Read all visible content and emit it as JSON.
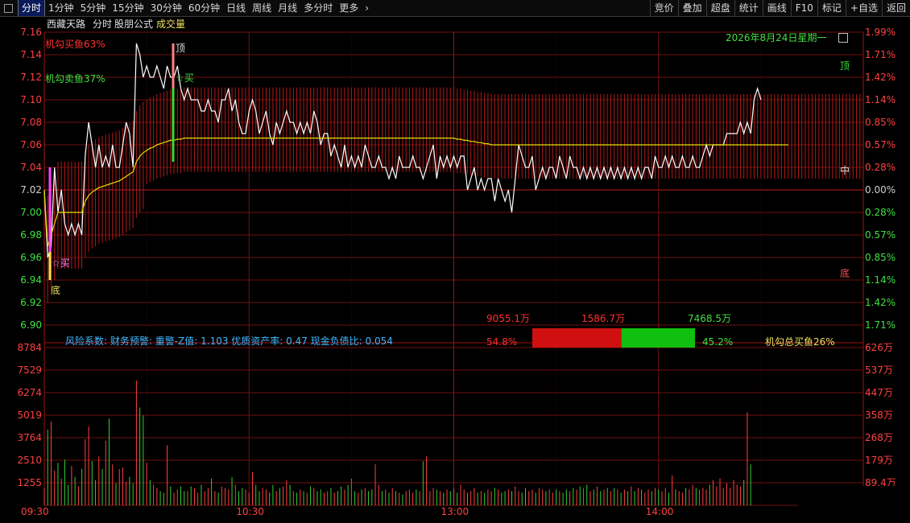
{
  "toolbar": {
    "left_tabs": [
      "分时",
      "1分钟",
      "5分钟",
      "15分钟",
      "30分钟",
      "60分钟",
      "日线",
      "周线",
      "月线",
      "多分时",
      "更多"
    ],
    "right_buttons": [
      "竞价",
      "叠加",
      "超盘",
      "统计",
      "画线",
      "F10",
      "标记",
      "+自选",
      "返回"
    ]
  },
  "header": {
    "stock_name": "西藏天路",
    "mode": "分时",
    "formula": "股朋公式",
    "indicator": "成交量",
    "date": "2026年8月24日星期一"
  },
  "price_axis": {
    "left": [
      "7.16",
      "7.14",
      "7.12",
      "7.10",
      "7.08",
      "7.06",
      "7.04",
      "7.02",
      "7.00",
      "6.98",
      "6.96",
      "6.94",
      "6.92",
      "6.90"
    ],
    "right": [
      "1.99%",
      "1.71%",
      "1.42%",
      "1.14%",
      "0.85%",
      "0.57%",
      "0.28%",
      "0.00%",
      "0.28%",
      "0.57%",
      "0.85%",
      "1.14%",
      "1.42%",
      "1.71%"
    ]
  },
  "volume_axis": {
    "left": [
      "8784",
      "7529",
      "6274",
      "5019",
      "3764",
      "2510",
      "1255"
    ],
    "right": [
      "626万",
      "537万",
      "447万",
      "358万",
      "268万",
      "179万",
      "89.4万"
    ]
  },
  "time_axis": [
    "09:30",
    "10:30",
    "13:00",
    "14:00"
  ],
  "annotations": {
    "sell_ratio": "机勾买鱼63%",
    "buy_ratio": "机勾卖鱼37%",
    "top_mark": "顶",
    "bottom_mark": "底",
    "buy_mark": "☆买",
    "right_top": "顶",
    "right_mid": "中",
    "right_bottom": "底",
    "risk_line": "风险系数: 财务预警: 重警-Z值: 1.103 优质资产率: 0.47 现金负债比: 0.054"
  },
  "flow": {
    "red_amount": "9055.1万",
    "mid_amount": "1586.7万",
    "green_amount": "7468.5万",
    "red_pct": "54.8%",
    "green_pct": "45.2%",
    "total": "机勾总买鱼26%",
    "red_fraction": 0.548
  },
  "chart_data": {
    "type": "line",
    "title": "西藏天路 分时",
    "prev_close": 7.02,
    "ylim": [
      6.9,
      7.16
    ],
    "series": [
      {
        "name": "price",
        "color": "#ffffff",
        "values": [
          7.02,
          6.96,
          6.97,
          7.04,
          7.0,
          7.02,
          6.99,
          6.98,
          6.99,
          6.98,
          6.99,
          6.98,
          7.05,
          7.08,
          7.06,
          7.04,
          7.06,
          7.04,
          7.05,
          7.04,
          7.06,
          7.04,
          7.04,
          7.06,
          7.08,
          7.07,
          7.04,
          7.15,
          7.14,
          7.12,
          7.13,
          7.12,
          7.12,
          7.13,
          7.12,
          7.11,
          7.13,
          7.12,
          7.12,
          7.13,
          7.11,
          7.1,
          7.11,
          7.1,
          7.1,
          7.1,
          7.09,
          7.09,
          7.1,
          7.09,
          7.09,
          7.08,
          7.1,
          7.1,
          7.11,
          7.09,
          7.1,
          7.08,
          7.07,
          7.07,
          7.09,
          7.1,
          7.09,
          7.07,
          7.08,
          7.09,
          7.07,
          7.06,
          7.08,
          7.07,
          7.08,
          7.09,
          7.08,
          7.08,
          7.07,
          7.08,
          7.07,
          7.08,
          7.07,
          7.09,
          7.08,
          7.06,
          7.07,
          7.07,
          7.05,
          7.06,
          7.05,
          7.04,
          7.06,
          7.04,
          7.05,
          7.04,
          7.05,
          7.04,
          7.06,
          7.05,
          7.04,
          7.04,
          7.05,
          7.04,
          7.04,
          7.03,
          7.04,
          7.03,
          7.05,
          7.04,
          7.04,
          7.04,
          7.05,
          7.04,
          7.04,
          7.03,
          7.04,
          7.05,
          7.06,
          7.03,
          7.05,
          7.04,
          7.05,
          7.04,
          7.05,
          7.04,
          7.05,
          7.05,
          7.02,
          7.03,
          7.04,
          7.02,
          7.03,
          7.02,
          7.03,
          7.03,
          7.01,
          7.03,
          7.02,
          7.01,
          7.02,
          7.0,
          7.03,
          7.06,
          7.05,
          7.04,
          7.04,
          7.05,
          7.02,
          7.03,
          7.04,
          7.03,
          7.04,
          7.04,
          7.03,
          7.05,
          7.04,
          7.03,
          7.05,
          7.04,
          7.04,
          7.03,
          7.04,
          7.03,
          7.04,
          7.03,
          7.04,
          7.03,
          7.04,
          7.03,
          7.04,
          7.03,
          7.04,
          7.03,
          7.04,
          7.03,
          7.04,
          7.03,
          7.04,
          7.03,
          7.04,
          7.04,
          7.03,
          7.05,
          7.04,
          7.04,
          7.05,
          7.04,
          7.05,
          7.04,
          7.04,
          7.05,
          7.04,
          7.04,
          7.05,
          7.04,
          7.04,
          7.05,
          7.06,
          7.05,
          7.06,
          7.06,
          7.06,
          7.06,
          7.07,
          7.07,
          7.07,
          7.07,
          7.08,
          7.07,
          7.08,
          7.07,
          7.1,
          7.11,
          7.1
        ]
      },
      {
        "name": "avg",
        "color": "#e8e000",
        "values": [
          7.02,
          6.97,
          6.98,
          6.99,
          7.0,
          7.0,
          7.0,
          7.0,
          7.0,
          7.0,
          7.0,
          7.0,
          7.01,
          7.015,
          7.018,
          7.02,
          7.022,
          7.023,
          7.024,
          7.025,
          7.026,
          7.027,
          7.028,
          7.03,
          7.032,
          7.034,
          7.036,
          7.045,
          7.05,
          7.053,
          7.055,
          7.057,
          7.058,
          7.06,
          7.061,
          7.062,
          7.063,
          7.064,
          7.064,
          7.065,
          7.065,
          7.066,
          7.066,
          7.066,
          7.066,
          7.066,
          7.066,
          7.066,
          7.066,
          7.066,
          7.066,
          7.066,
          7.066,
          7.066,
          7.066,
          7.066,
          7.066,
          7.066,
          7.066,
          7.066,
          7.066,
          7.066,
          7.066,
          7.066,
          7.066,
          7.066,
          7.066,
          7.066,
          7.066,
          7.066,
          7.066,
          7.066,
          7.066,
          7.066,
          7.066,
          7.066,
          7.066,
          7.066,
          7.066,
          7.066,
          7.066,
          7.066,
          7.066,
          7.066,
          7.066,
          7.066,
          7.066,
          7.066,
          7.066,
          7.066,
          7.066,
          7.066,
          7.066,
          7.066,
          7.066,
          7.066,
          7.066,
          7.066,
          7.066,
          7.066,
          7.066,
          7.066,
          7.066,
          7.066,
          7.066,
          7.066,
          7.066,
          7.066,
          7.066,
          7.066,
          7.066,
          7.066,
          7.066,
          7.066,
          7.066,
          7.066,
          7.066,
          7.066,
          7.066,
          7.066,
          7.066,
          7.065,
          7.065,
          7.064,
          7.064,
          7.063,
          7.063,
          7.062,
          7.062,
          7.061,
          7.061,
          7.06,
          7.06,
          7.06,
          7.06,
          7.06,
          7.06,
          7.06,
          7.06,
          7.06,
          7.06,
          7.06,
          7.06,
          7.06,
          7.06,
          7.06,
          7.06,
          7.06,
          7.06,
          7.06,
          7.06,
          7.06,
          7.06,
          7.06,
          7.06,
          7.06,
          7.06,
          7.06,
          7.06,
          7.06,
          7.06,
          7.06,
          7.06,
          7.06,
          7.06,
          7.06,
          7.06,
          7.06,
          7.06,
          7.06,
          7.06,
          7.06,
          7.06,
          7.06,
          7.06,
          7.06,
          7.06,
          7.06,
          7.06,
          7.06,
          7.06,
          7.06,
          7.06,
          7.06,
          7.06,
          7.06,
          7.06,
          7.06,
          7.06,
          7.06,
          7.06,
          7.06,
          7.06,
          7.06,
          7.06,
          7.06,
          7.06,
          7.06,
          7.06,
          7.06,
          7.06,
          7.06,
          7.06,
          7.06,
          7.06,
          7.06,
          7.06,
          7.06,
          7.06,
          7.06,
          7.06,
          7.06,
          7.06,
          7.06,
          7.06,
          7.06,
          7.06,
          7.06,
          7.06
        ]
      }
    ],
    "volume": [
      1100,
      4800,
      5300,
      2200,
      2700,
      1700,
      2900,
      1300,
      2500,
      1800,
      1200,
      2300,
      4200,
      5000,
      2800,
      1600,
      3100,
      2300,
      4100,
      5500,
      2600,
      1400,
      2300,
      2400,
      1500,
      1800,
      1400,
      7900,
      6200,
      5700,
      2700,
      1600,
      1300,
      1100,
      900,
      800,
      3800,
      1200,
      800,
      1000,
      1200,
      900,
      900,
      1200,
      1100,
      800,
      1300,
      900,
      1100,
      1700,
      900,
      800,
      1200,
      1100,
      1000,
      1800,
      1300,
      900,
      1100,
      1000,
      800,
      2100,
      1300,
      900,
      1100,
      1000,
      800,
      1300,
      900,
      1100,
      1200,
      1600,
      1300,
      900,
      800,
      1000,
      900,
      800,
      1200,
      1100,
      900,
      1000,
      800,
      900,
      1100,
      800,
      900,
      1200,
      1000,
      1300,
      1700,
      900,
      800,
      1000,
      1100,
      900,
      1000,
      2600,
      1300,
      900,
      1000,
      800,
      1100,
      900,
      800,
      700,
      900,
      1000,
      800,
      1000,
      900,
      2800,
      3100,
      900,
      1100,
      1000,
      900,
      800,
      1000,
      900,
      1100,
      800,
      1300,
      1000,
      800,
      900,
      1100,
      800,
      900,
      800,
      1000,
      900,
      1100,
      1000,
      800,
      900,
      1000,
      900,
      1200,
      900,
      800,
      1100,
      900,
      1000,
      800,
      1100,
      1000,
      900,
      1000,
      800,
      1000,
      900,
      800,
      1000,
      900,
      1100,
      1000,
      1200,
      1100,
      1300,
      900,
      1000,
      1200,
      900,
      1000,
      1100,
      900,
      1100,
      1000,
      800,
      1000,
      900,
      1200,
      900,
      1100,
      1000,
      800,
      1000,
      900,
      1100,
      1000,
      900,
      1100,
      800,
      1900,
      1000,
      900,
      800,
      1100,
      1000,
      1300,
      1100,
      1000,
      1100,
      1000,
      1300,
      1600,
      1200,
      1700,
      1100,
      1400,
      1100,
      1600,
      1300,
      1200,
      1600,
      5900,
      2600
    ]
  }
}
